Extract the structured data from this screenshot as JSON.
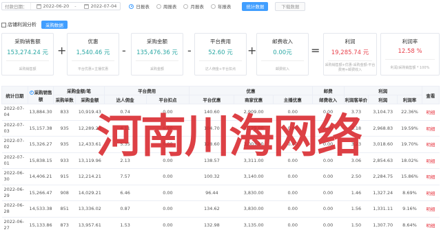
{
  "filter": {
    "date_label": "付款日期：",
    "start_date": "2022-06-20",
    "end_date": "2022-07-04",
    "separator": "-",
    "periods": [
      "日报表",
      "周报表",
      "月报表",
      "年报表"
    ],
    "selected_period": "日报表",
    "stat_button": "统计数据",
    "download_button": "下载数据"
  },
  "analysis": {
    "title": "店铺利润分析",
    "purchase_button": "采购数据"
  },
  "cards": [
    {
      "title": "采购销售额",
      "value": "153,274.24 元",
      "desc": "采购销售额"
    },
    {
      "title": "优惠",
      "value": "1,540.46 元",
      "desc": "平台优惠+主播优惠"
    },
    {
      "title": "采购金额",
      "value": "135,476.36 元",
      "desc": "采购金额"
    },
    {
      "title": "平台费用",
      "value": "52.60 元",
      "desc": "达人佣金+平台扣点"
    },
    {
      "title": "邮费收入",
      "value": "0.00元",
      "desc": "邮费收入"
    },
    {
      "title": "利润",
      "value": "19,285.74 元",
      "desc": "采购销售额+优惠-采购金额-平台费用+邮费收入"
    },
    {
      "title": "利润率",
      "value": "12.58 %",
      "desc": "利润/采购销售额 * 100%"
    }
  ],
  "operators": [
    "+",
    "-",
    "-",
    "+",
    "="
  ],
  "table": {
    "group_headers": {
      "date": "统计日期",
      "sales": "采购销售额",
      "amount_group": "采购金额/笔",
      "platform_group": "平台费用",
      "discount_group": "优惠",
      "postage_group": "邮费",
      "profit_group": "利润",
      "view": "查看"
    },
    "sub_headers": [
      "采购单数",
      "采购金额",
      "达人佣金",
      "平台扣点",
      "平台优惠",
      "商家优惠",
      "主播优惠",
      "邮费收入",
      "利润客单价",
      "利润",
      "利润率"
    ],
    "rows": [
      {
        "date": "2022-07-04",
        "sales": "13,884.30",
        "count": "833",
        "amount": "10,919.43",
        "commission": "0.74",
        "deduct": "0.00",
        "platform_disc": "140.60",
        "merchant_disc": "2,909.00",
        "anchor_disc": "0.00",
        "postage": "0.00",
        "unit_profit": "3.73",
        "profit": "3,104.73",
        "rate": "22.36%",
        "view": "明细"
      },
      {
        "date": "2022-07-03",
        "sales": "15,157.38",
        "count": "935",
        "amount": "12,289.20",
        "commission": "4.11",
        "deduct": "0.00",
        "platform_disc": "104.70",
        "merchant_disc": "3,129.00",
        "anchor_disc": "0.00",
        "postage": "0.00",
        "unit_profit": "3.18",
        "profit": "2,968.83",
        "rate": "19.59%",
        "view": "明细"
      },
      {
        "date": "2022-07-02",
        "sales": "15,326.27",
        "count": "935",
        "amount": "12,433.61",
        "commission": "5.35",
        "deduct": "0.00",
        "platform_disc": "128.60",
        "merchant_disc": "3,003.00",
        "anchor_disc": "0.00",
        "postage": "0.00",
        "unit_profit": "3.23",
        "profit": "3,018.60",
        "rate": "19.70%",
        "view": "明细"
      },
      {
        "date": "2022-07-01",
        "sales": "15,838.15",
        "count": "933",
        "amount": "13,119.96",
        "commission": "2.13",
        "deduct": "0.00",
        "platform_disc": "138.57",
        "merchant_disc": "3,311.00",
        "anchor_disc": "0.00",
        "postage": "0.00",
        "unit_profit": "3.06",
        "profit": "2,854.63",
        "rate": "18.02%",
        "view": "明细"
      },
      {
        "date": "2022-06-30",
        "sales": "14,406.21",
        "count": "915",
        "amount": "12,214.21",
        "commission": "7.57",
        "deduct": "0.00",
        "platform_disc": "100.32",
        "merchant_disc": "3,140.00",
        "anchor_disc": "0.00",
        "postage": "0.00",
        "unit_profit": "2.50",
        "profit": "2,284.75",
        "rate": "15.86%",
        "view": "明细"
      },
      {
        "date": "2022-06-29",
        "sales": "15,266.47",
        "count": "908",
        "amount": "14,029.21",
        "commission": "6.46",
        "deduct": "0.00",
        "platform_disc": "96.44",
        "merchant_disc": "3,830.00",
        "anchor_disc": "0.00",
        "postage": "0.00",
        "unit_profit": "1.46",
        "profit": "1,327.24",
        "rate": "8.69%",
        "view": "明细"
      },
      {
        "date": "2022-06-28",
        "sales": "14,533.38",
        "count": "851",
        "amount": "13,336.02",
        "commission": "0.87",
        "deduct": "0.00",
        "platform_disc": "134.62",
        "merchant_disc": "3,830.00",
        "anchor_disc": "0.00",
        "postage": "0.00",
        "unit_profit": "1.56",
        "profit": "1,331.11",
        "rate": "9.16%",
        "view": "明细"
      },
      {
        "date": "2022-06-27",
        "sales": "15,133.86",
        "count": "873",
        "amount": "13,957.61",
        "commission": "1.53",
        "deduct": "0.00",
        "platform_disc": "132.98",
        "merchant_disc": "3,135.00",
        "anchor_disc": "0.00",
        "postage": "0.00",
        "unit_profit": "1.50",
        "profit": "1,307.70",
        "rate": "8.64%",
        "view": "明细"
      }
    ]
  },
  "watermark": "河南川海网络"
}
